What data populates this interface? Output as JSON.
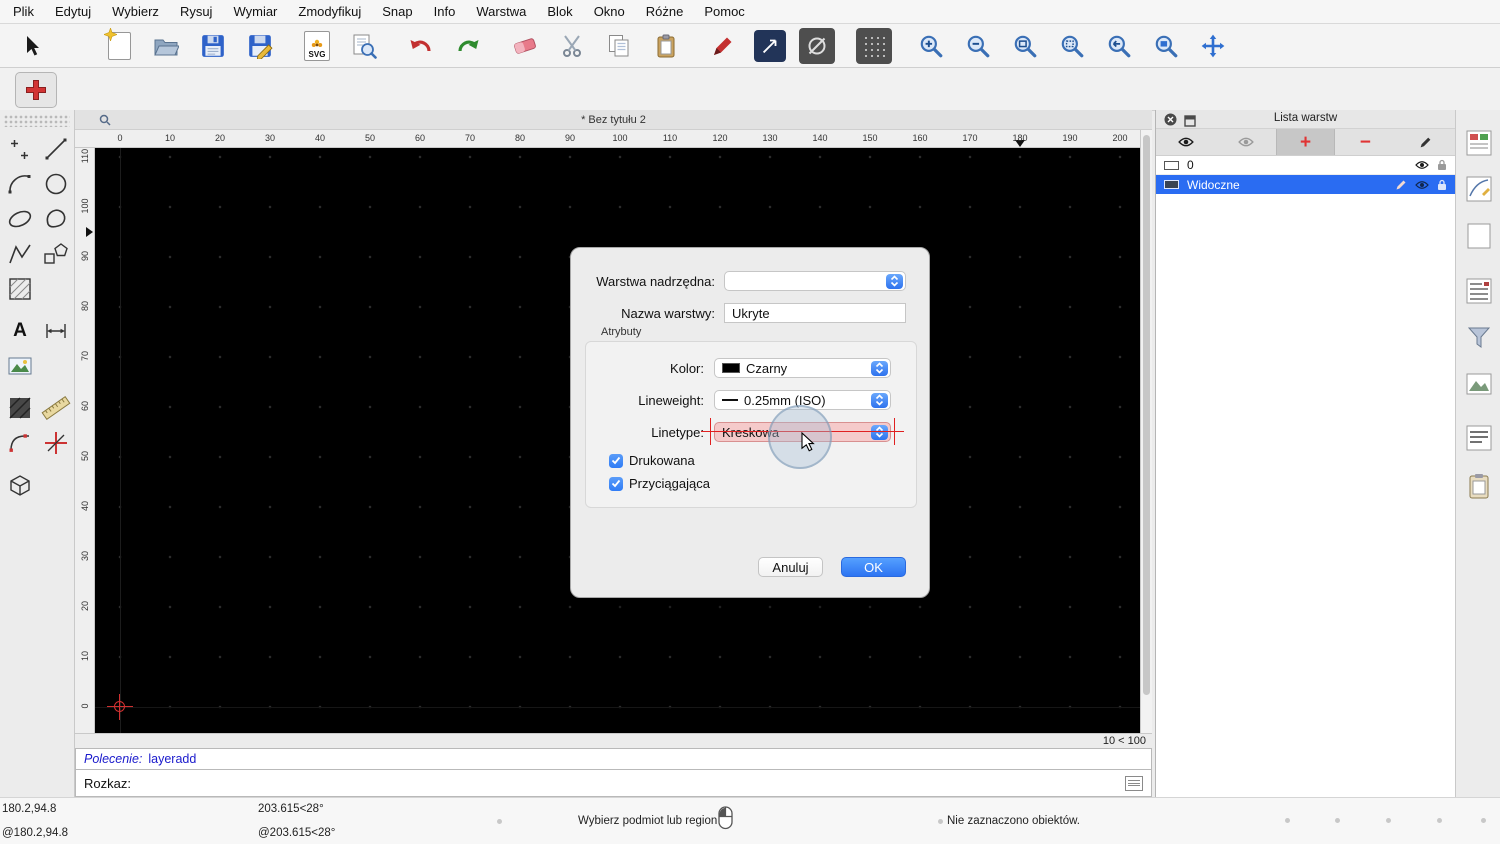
{
  "colors": {
    "accent_blue": "#2f7cf6",
    "selection_blue": "#2a6cf2",
    "canvas_black": "#000000",
    "annotation_red": "#e02020"
  },
  "menubar": {
    "items": [
      "Plik",
      "Edytuj",
      "Wybierz",
      "Rysuj",
      "Wymiar",
      "Zmodyfikuj",
      "Snap",
      "Info",
      "Warstwa",
      "Blok",
      "Okno",
      "Różne",
      "Pomoc"
    ]
  },
  "toolbar": {
    "svg_label": "SVG"
  },
  "document": {
    "tab_title": "* Bez tytułu 2",
    "grid_status": "10 < 100"
  },
  "rulers": {
    "top": [
      "0",
      "10",
      "20",
      "30",
      "40",
      "50",
      "60",
      "70",
      "80",
      "90",
      "100",
      "110",
      "120",
      "130",
      "140",
      "150",
      "160",
      "170",
      "180",
      "190",
      "200"
    ],
    "left": [
      "0",
      "10",
      "20",
      "30",
      "40",
      "50",
      "60",
      "70",
      "80",
      "90",
      "100",
      "110"
    ]
  },
  "dialog": {
    "parent_layer_label": "Warstwa nadrzędna:",
    "name_label": "Nazwa warstwy:",
    "name_value": "Ukryte",
    "attributes_label": "Atrybuty",
    "color_label": "Kolor:",
    "color_value": "Czarny",
    "lineweight_label": "Lineweight:",
    "lineweight_value": "0.25mm (ISO)",
    "linetype_label": "Linetype:",
    "linetype_value": "Kreskowa",
    "printable_label": "Drukowana",
    "snappable_label": "Przyciągająca",
    "cancel_label": "Anuluj",
    "ok_label": "OK"
  },
  "layer_panel": {
    "title": "Lista warstw",
    "rows": [
      {
        "name": "0"
      },
      {
        "name": "Widoczne"
      }
    ]
  },
  "command": {
    "history_label": "Polecenie:",
    "history_value": "layeradd",
    "prompt_label": "Rozkaz:"
  },
  "statusbar": {
    "absolute_coord": "180.2,94.8",
    "relative_coord": "@180.2,94.8",
    "absolute_polar": "203.615<28°",
    "relative_polar": "@203.615<28°",
    "hint": "Wybierz podmiot lub region",
    "selection_info": "Nie zaznaczono obiektów."
  },
  "palette": {
    "text_tool_glyph": "A"
  }
}
